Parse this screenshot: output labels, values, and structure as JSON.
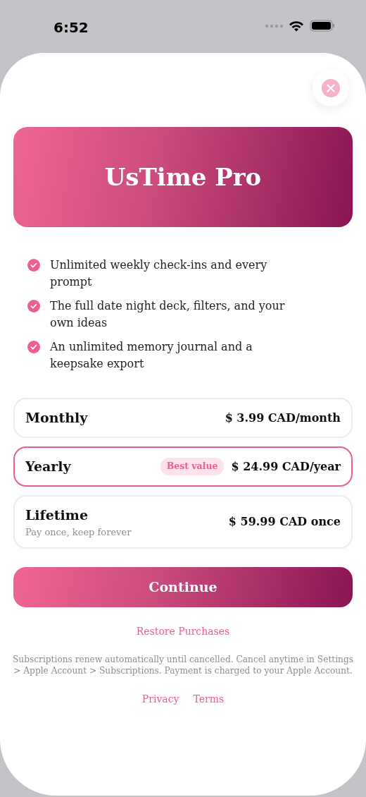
{
  "status_bar": {
    "time": "6:52"
  },
  "header": {
    "title": "UsTime Pro"
  },
  "features": [
    {
      "text": "Unlimited weekly check-ins and every prompt"
    },
    {
      "text": "The full date night deck, filters, and your own ideas"
    },
    {
      "text": "An unlimited memory journal and a keepsake export"
    }
  ],
  "plans": [
    {
      "name": "Monthly",
      "price": "$ 3.99 CAD/month",
      "selected": false
    },
    {
      "name": "Yearly",
      "badge": "Best value",
      "price": "$ 24.99 CAD/year",
      "selected": true
    },
    {
      "name": "Lifetime",
      "subtitle": "Pay once, keep forever",
      "price": "$ 59.99 CAD once",
      "selected": false
    }
  ],
  "continue_button": "Continue",
  "restore_link": "Restore Purchases",
  "disclaimer": "Subscriptions renew automatically until cancelled. Cancel anytime in Settings > Apple Account > Subscriptions. Payment is charged to your Apple Account.",
  "footer_links": [
    "Privacy",
    "Terms"
  ]
}
